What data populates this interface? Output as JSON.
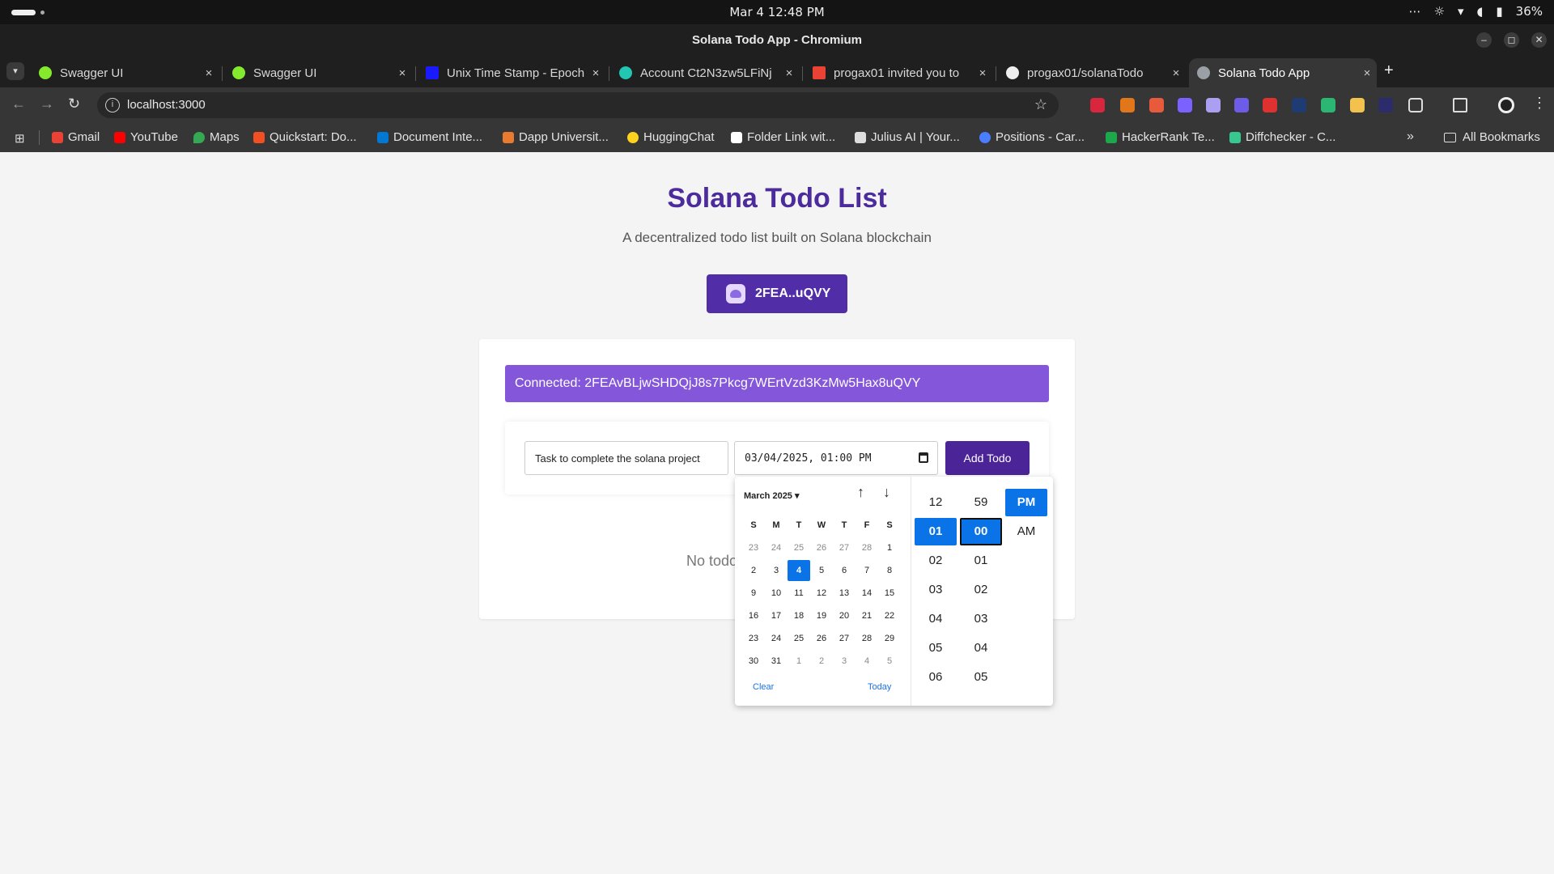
{
  "os": {
    "clock": "Mar 4  12:48 PM",
    "tray_more": "⋯",
    "battery": "36%"
  },
  "window": {
    "title": "Solana Todo App - Chromium",
    "minimize": "–",
    "restore": "◻",
    "close": "✕"
  },
  "tabs": [
    {
      "label": "Swagger UI",
      "color": "#85ea2d"
    },
    {
      "label": "Swagger UI",
      "color": "#85ea2d"
    },
    {
      "label": "Unix Time Stamp - Epoch",
      "color": "#1a1aff"
    },
    {
      "label": "Account Ct2N3zw5LFiNj",
      "color": "#21c7b2"
    },
    {
      "label": "progax01 invited you to",
      "color": "#ea4335"
    },
    {
      "label": "progax01/solanaTodo",
      "color": "#eeeeee"
    },
    {
      "label": "Solana Todo App",
      "color": "#9aa0a6"
    }
  ],
  "tab_close": "×",
  "new_tab": "+",
  "toolbar": {
    "back": "←",
    "forward": "→",
    "reload": "↻",
    "url": "localhost:3000",
    "info": "i",
    "star": "☆",
    "menu": "⋮"
  },
  "bookmarks": {
    "apps": "⊞",
    "items": [
      {
        "label": "Gmail",
        "color": "#ea4335"
      },
      {
        "label": "YouTube",
        "color": "#ff0000"
      },
      {
        "label": "Maps",
        "color": "#34a853"
      },
      {
        "label": "Quickstart: Do...",
        "color": "#f25022"
      },
      {
        "label": "Document Inte...",
        "color": "#0078d4"
      },
      {
        "label": "Dapp Universit...",
        "color": "#e87b2f"
      },
      {
        "label": "HuggingChat",
        "color": "#ffd21e"
      },
      {
        "label": "Folder Link wit...",
        "color": "#ffffff"
      },
      {
        "label": "Julius AI | Your...",
        "color": "#dddddd"
      },
      {
        "label": "Positions - Car...",
        "color": "#4a7dff"
      },
      {
        "label": "HackerRank Te...",
        "color": "#1ba94c"
      },
      {
        "label": "Diffchecker - C...",
        "color": "#36c88f"
      }
    ],
    "more": "»",
    "all": "All Bookmarks"
  },
  "app": {
    "title": "Solana Todo List",
    "subtitle": "A decentralized todo list built on Solana blockchain",
    "wallet_label": "2FEA..uQVY",
    "connected": "Connected: 2FEAvBLjwSHDQjJ8s7Pkcg7WErtVzd3KzMw5Hax8uQVY",
    "task_value": "Task to complete the solana project",
    "datetime_value": "03/04/2025, 01:00 PM",
    "add_button": "Add Todo",
    "empty_text": "No todo"
  },
  "picker": {
    "month_label": "March 2025 ▾",
    "up": "↑",
    "down": "↓",
    "weekdays": [
      "S",
      "M",
      "T",
      "W",
      "T",
      "F",
      "S"
    ],
    "days": [
      [
        "23",
        "24",
        "25",
        "26",
        "27",
        "28",
        "1"
      ],
      [
        "2",
        "3",
        "4",
        "5",
        "6",
        "7",
        "8"
      ],
      [
        "9",
        "10",
        "11",
        "12",
        "13",
        "14",
        "15"
      ],
      [
        "16",
        "17",
        "18",
        "19",
        "20",
        "21",
        "22"
      ],
      [
        "23",
        "24",
        "25",
        "26",
        "27",
        "28",
        "29"
      ],
      [
        "30",
        "31",
        "1",
        "2",
        "3",
        "4",
        "5"
      ]
    ],
    "selected_day": "4",
    "clear": "Clear",
    "today": "Today",
    "hours": [
      "12",
      "01",
      "02",
      "03",
      "04",
      "05",
      "06"
    ],
    "selected_hour": "01",
    "minutes": [
      "59",
      "00",
      "01",
      "02",
      "03",
      "04",
      "05"
    ],
    "selected_minute": "00",
    "meridiem": [
      "PM",
      "AM"
    ],
    "selected_meridiem": "PM"
  },
  "colors": {
    "accent": "#512da8",
    "title": "#4c2b9c",
    "connected_bg": "#8456d9",
    "picker_selected": "#0a73e8"
  }
}
